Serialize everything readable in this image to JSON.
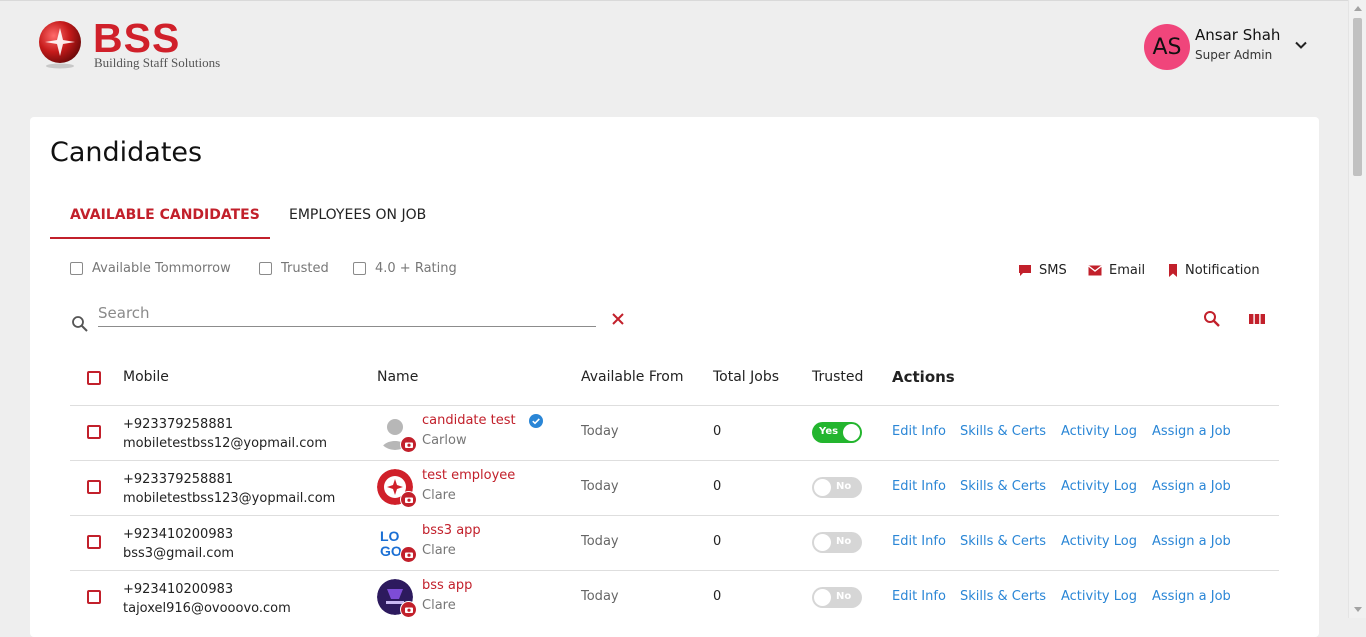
{
  "brand": {
    "name": "BSS",
    "tagline": "Building Staff Solutions",
    "color": "#d0202a"
  },
  "user": {
    "initials": "AS",
    "name": "Ansar Shah",
    "role": "Super Admin",
    "avatar_color": "#f0457b",
    "menu_icon": "chevron-down-icon"
  },
  "page": {
    "title": "Candidates"
  },
  "tabs": [
    {
      "label": "AVAILABLE CANDIDATES",
      "active": true
    },
    {
      "label": "EMPLOYEES ON JOB",
      "active": false
    }
  ],
  "filters": [
    {
      "label": "Available Tommorrow",
      "checked": false
    },
    {
      "label": "Trusted",
      "checked": false
    },
    {
      "label": "4.0 + Rating",
      "checked": false
    }
  ],
  "bulk_actions": [
    {
      "label": "SMS",
      "icon": "chat-bubble-icon"
    },
    {
      "label": "Email",
      "icon": "envelope-icon"
    },
    {
      "label": "Notification",
      "icon": "bookmark-icon"
    }
  ],
  "search": {
    "placeholder": "Search",
    "value": ""
  },
  "table": {
    "columns": [
      "Mobile",
      "Name",
      "Available From",
      "Total Jobs",
      "Trusted",
      "Actions"
    ],
    "action_links": [
      "Edit Info",
      "Skills & Certs",
      "Activity Log",
      "Assign a Job"
    ],
    "rows": [
      {
        "phone": "+923379258881",
        "email": "mobiletestbss12@yopmail.com",
        "name": "candidate test",
        "city": "Carlow",
        "verified": true,
        "available_from": "Today",
        "total_jobs": "0",
        "trusted": true,
        "trusted_label": "Yes",
        "avatar": "default-person"
      },
      {
        "phone": "+923379258881",
        "email": "mobiletestbss123@yopmail.com",
        "name": "test employee",
        "city": "Clare",
        "verified": false,
        "available_from": "Today",
        "total_jobs": "0",
        "trusted": false,
        "trusted_label": "No",
        "avatar": "bss-logo"
      },
      {
        "phone": "+923410200983",
        "email": "bss3@gmail.com",
        "name": "bss3 app",
        "city": "Clare",
        "verified": false,
        "available_from": "Today",
        "total_jobs": "0",
        "trusted": false,
        "trusted_label": "No",
        "avatar": "logo-text"
      },
      {
        "phone": "+923410200983",
        "email": "tajoxel916@ovooovo.com",
        "name": "bss app",
        "city": "Clare",
        "verified": false,
        "available_from": "Today",
        "total_jobs": "0",
        "trusted": false,
        "trusted_label": "No",
        "avatar": "purple-graphic"
      }
    ]
  },
  "colors": {
    "accent": "#c2202b",
    "link": "#2a86d6",
    "toggle_on": "#23b52e",
    "toggle_off": "#d6d6d6"
  }
}
